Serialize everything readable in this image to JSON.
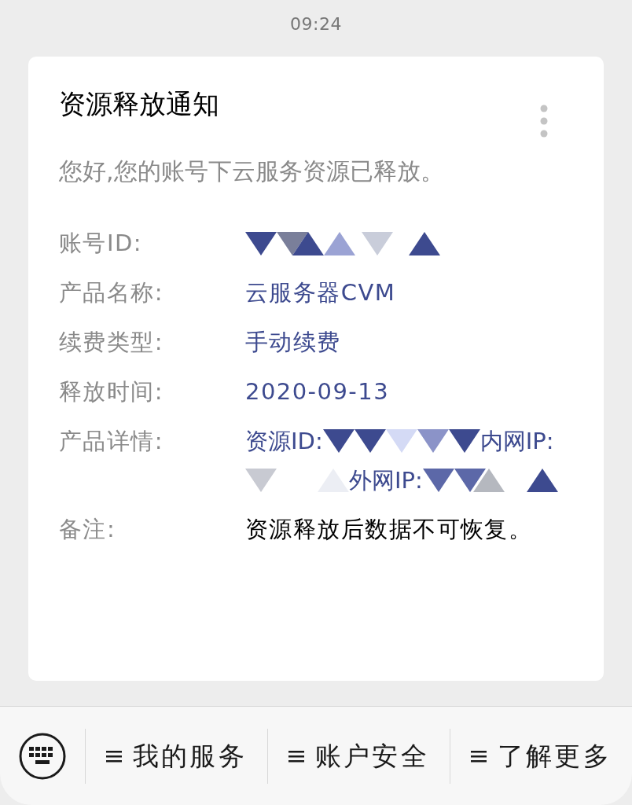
{
  "status_bar": {
    "time": "09:24"
  },
  "card": {
    "title": "资源释放通知",
    "greeting": "您好,您的账号下云服务资源已释放。",
    "fields": [
      {
        "label": "账号ID:",
        "kind": "redacted"
      },
      {
        "label": "产品名称:",
        "kind": "text",
        "value": "云服务器CVM"
      },
      {
        "label": "续费类型:",
        "kind": "text",
        "value": "手动续费"
      },
      {
        "label": "释放时间:",
        "kind": "text",
        "value": "2020-09-13"
      },
      {
        "label": "产品详情:",
        "kind": "details",
        "parts": [
          "资源ID:",
          "内网IP:",
          "外网IP:"
        ]
      },
      {
        "label": "备注:",
        "kind": "note",
        "value": "资源释放后数据不可恢复。"
      }
    ]
  },
  "menu_bar": {
    "items": [
      "我的服务",
      "账户安全",
      "了解更多"
    ]
  }
}
